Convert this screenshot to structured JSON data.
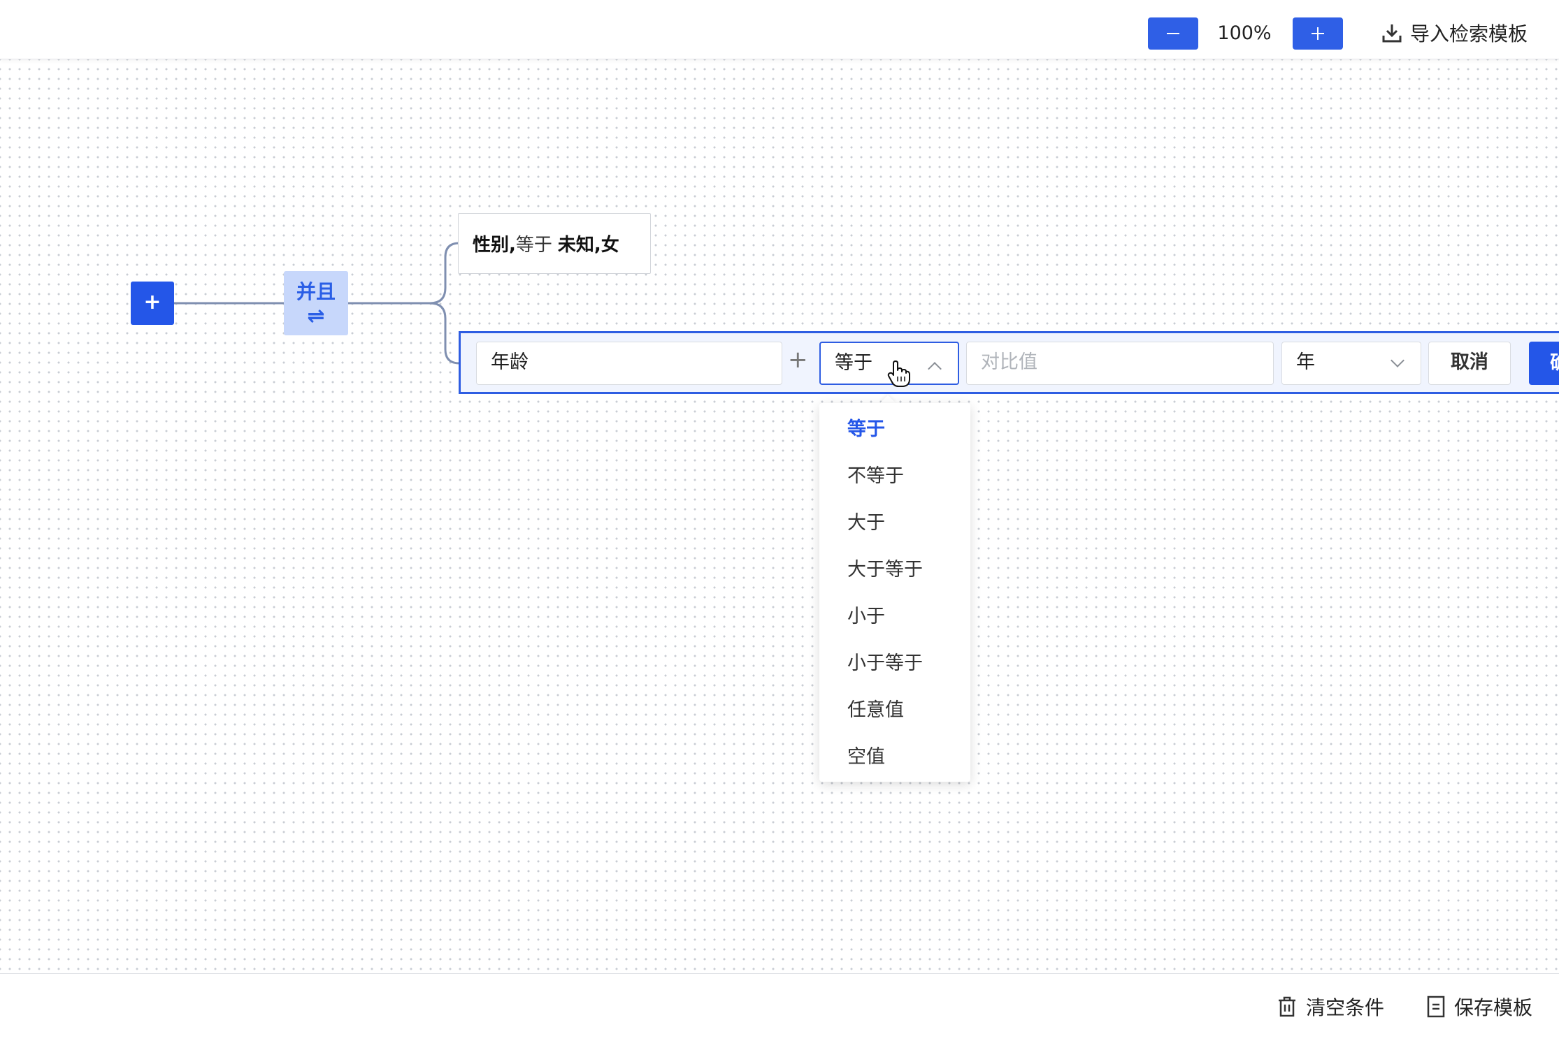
{
  "toolbar": {
    "zoom_out_icon": "minus-icon",
    "zoom_level": "100%",
    "zoom_in_icon": "plus-icon",
    "import_label": "导入检索模板",
    "import_icon": "download-icon"
  },
  "tree": {
    "root_add_label": "+",
    "logic_node": {
      "label": "并且",
      "swap_icon": "⇌"
    },
    "conditions": [
      {
        "field": "性别,",
        "operator": "等于",
        "value": "未知,女"
      }
    ]
  },
  "editor": {
    "field_value": "年龄",
    "plus_sep": "+",
    "operator_value": "等于",
    "compare_placeholder": "对比值",
    "unit_value": "年",
    "cancel_label": "取消",
    "confirm_label": "确"
  },
  "operator_options": [
    "等于",
    "不等于",
    "大于",
    "大于等于",
    "小于",
    "小于等于",
    "任意值",
    "空值"
  ],
  "operator_selected_index": 0,
  "footer": {
    "clear_label": "清空条件",
    "clear_icon": "trash-icon",
    "save_label": "保存模板",
    "save_icon": "document-icon"
  },
  "colors": {
    "primary": "#2456e8",
    "logic_node_bg": "#c7d7fb",
    "connector": "#7f8fb0"
  }
}
